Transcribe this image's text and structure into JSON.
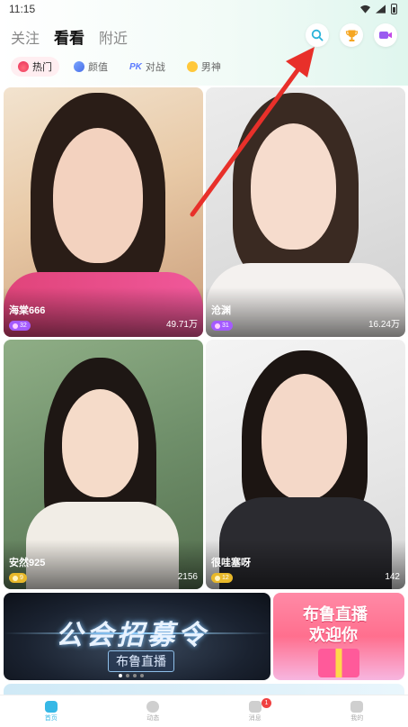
{
  "status_bar": {
    "time": "11:15"
  },
  "top_tabs": [
    {
      "label": "关注"
    },
    {
      "label": "看看"
    },
    {
      "label": "附近"
    }
  ],
  "active_tab": "看看",
  "categories": [
    {
      "label": "热门",
      "icon": "flame-icon"
    },
    {
      "label": "颜值",
      "icon": "heart-icon"
    },
    {
      "label": "对战",
      "icon": "pk-icon"
    },
    {
      "label": "男神",
      "icon": "sunglasses-icon"
    }
  ],
  "streams": [
    {
      "name": "海棠666",
      "level": "32",
      "viewers": "49.71万"
    },
    {
      "name": "沧渊",
      "level": "31",
      "viewers": "16.24万"
    },
    {
      "name": "安然925",
      "level": "9",
      "viewers": "2156"
    },
    {
      "name": "很哇塞呀",
      "level": "12",
      "viewers": "142"
    }
  ],
  "banners": [
    {
      "title": "公会招募令",
      "subtitle": "布鲁直播"
    },
    {
      "title": "布鲁直播",
      "subtitle": "欢迎你"
    }
  ],
  "bottom_nav": [
    {
      "label": "首页",
      "icon": "home-icon"
    },
    {
      "label": "动态",
      "icon": "compass-icon"
    },
    {
      "label": "消息",
      "icon": "message-icon",
      "badge": "1"
    },
    {
      "label": "我的",
      "icon": "profile-icon"
    }
  ],
  "colors": {
    "accent": "#36b8e6",
    "arrow": "#e8302a",
    "badge_purple": "#a45bff",
    "badge_yellow": "#e8b82a"
  }
}
